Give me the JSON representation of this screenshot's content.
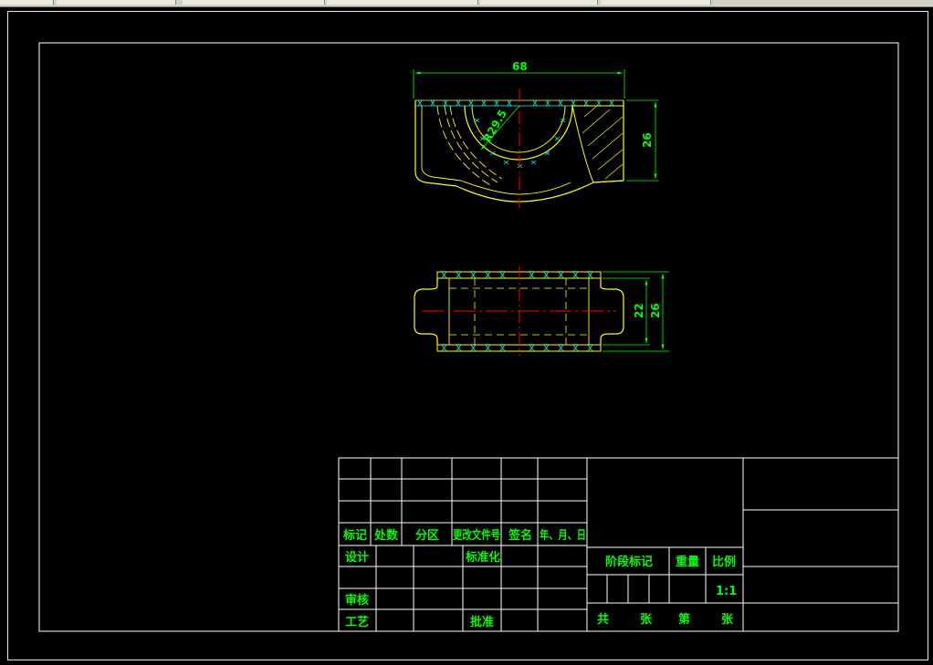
{
  "top_tabs": [
    "",
    "",
    "",
    "",
    "",
    ""
  ],
  "drawing": {
    "dimensions": {
      "front_width": "68",
      "front_radius": "R29.5",
      "front_height": "26",
      "plan_inner": "22",
      "plan_outer": "26"
    }
  },
  "title_block": {
    "revision_headers": {
      "mark": "标记",
      "count": "处数",
      "zone": "分区",
      "change_doc": "更改文件号",
      "signature": "签名",
      "date": "年、月、日"
    },
    "design": "设计",
    "standardization": "标准化",
    "review": "审核",
    "process": "工艺",
    "approval": "批准",
    "stage_mark": "阶段标记",
    "weight": "重量",
    "scale": "比例",
    "scale_value": "1:1",
    "total": "共",
    "sheets": "张",
    "sheet_no": "第",
    "sheets2": "张"
  },
  "colors": {
    "background": "#000000",
    "outline": "#ffff00",
    "hatch": "#00ffff",
    "dimension": "#00ff00",
    "centerline": "#ff0000",
    "frame": "#ffffff"
  }
}
